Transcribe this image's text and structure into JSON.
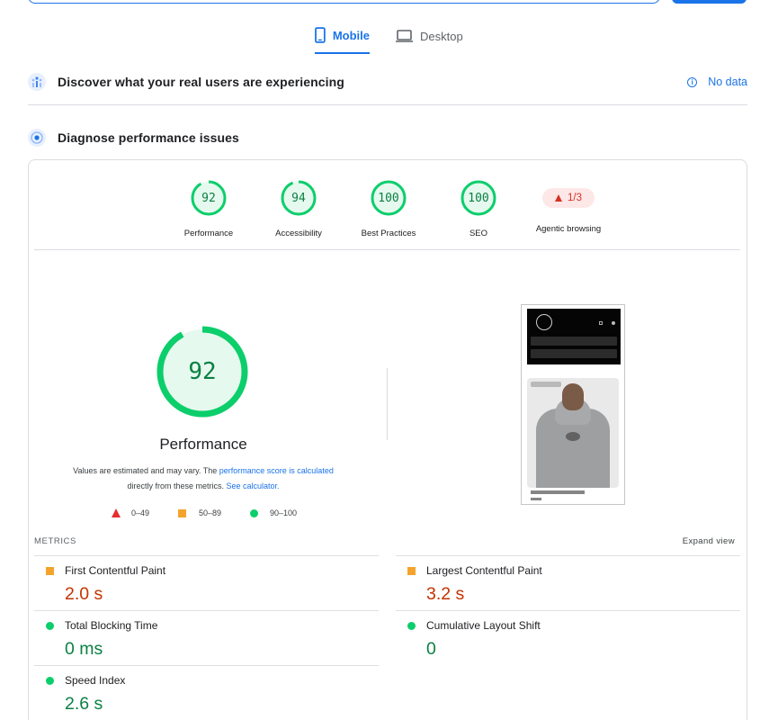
{
  "tabs": {
    "mobile": "Mobile",
    "desktop": "Desktop"
  },
  "field_data": {
    "title": "Discover what your real users are experiencing",
    "no_data": "No data"
  },
  "diagnose": {
    "title": "Diagnose performance issues"
  },
  "categories": [
    {
      "label": "Performance",
      "score": "92"
    },
    {
      "label": "Accessibility",
      "score": "94"
    },
    {
      "label": "Best Practices",
      "score": "100"
    },
    {
      "label": "SEO",
      "score": "100"
    },
    {
      "label": "Agentic browsing",
      "score": "1/3"
    }
  ],
  "score_fractions": [
    0.92,
    0.94,
    1.0,
    1.0
  ],
  "performance": {
    "score": "92",
    "title": "Performance",
    "note_prefix": "Values are estimated and may vary. The ",
    "note_link1": "performance score is calculated",
    "note_middle": " directly from these metrics. ",
    "note_link2": "See calculator."
  },
  "legend": {
    "fail": "0–49",
    "average": "50–89",
    "pass": "90–100"
  },
  "metrics_header": "METRICS",
  "expand_view": "Expand view",
  "metrics": [
    {
      "name": "First Contentful Paint",
      "value": "2.0 s",
      "status": "average"
    },
    {
      "name": "Largest Contentful Paint",
      "value": "3.2 s",
      "status": "average"
    },
    {
      "name": "Total Blocking Time",
      "value": "0 ms",
      "status": "pass"
    },
    {
      "name": "Cumulative Layout Shift",
      "value": "0",
      "status": "pass"
    },
    {
      "name": "Speed Index",
      "value": "2.6 s",
      "status": "pass"
    }
  ],
  "colors": {
    "pass": "#0cce6b",
    "pass_text": "#0b8043",
    "average": "#f4a42d",
    "average_text": "#c33300",
    "fail": "#e3302f",
    "accent": "#1a73e8"
  }
}
